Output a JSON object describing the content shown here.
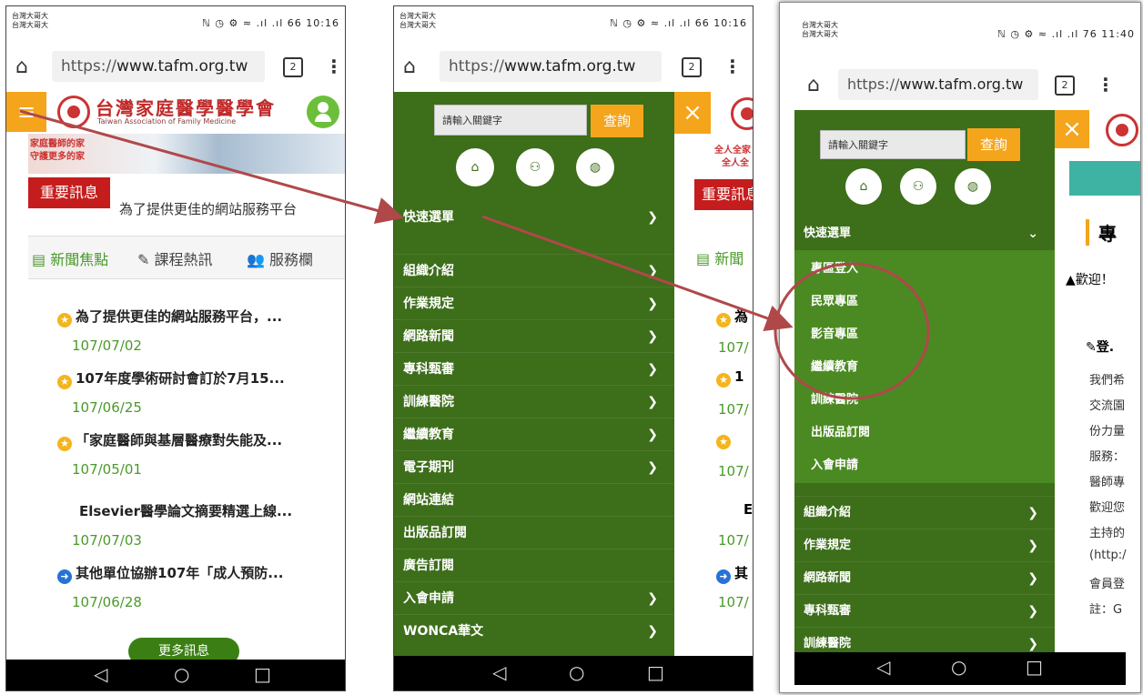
{
  "status": {
    "carrier1": "台灣大哥大\n台灣大哥大",
    "icons1": "ℕ ◷ ⚙ ≈ .ıl .ıl 66 10:16",
    "carrier3": "台灣大哥大\n台灣大哥大",
    "icons3": "ℕ ◷ ⚙ ≈ .ıl .ıl 76 11:40"
  },
  "browser": {
    "url_prefix": "https://",
    "url_host": "www.tafm.org.tw",
    "tab_count": "2"
  },
  "site": {
    "title": "台灣家庭醫學醫學會",
    "subtitle": "Taiwan Association of Family Medicine",
    "banner_lines": [
      "家庭醫師的家",
      "守護更多的家"
    ],
    "banner_peek": [
      "全人全家",
      "全人全"
    ],
    "important": "重要訊息",
    "marquee": "為了提供更佳的網站服務平台",
    "tabs": [
      "新聞焦點",
      "課程熱訊",
      "服務欄"
    ],
    "tab_peek": "新聞",
    "news": [
      {
        "title": "為了提供更佳的網站服務平台，...",
        "date": "107/07/02",
        "icon": "star"
      },
      {
        "title": "107年度學術研討會訂於7月15...",
        "date": "107/06/25",
        "icon": "star"
      },
      {
        "title": "「家庭醫師與基層醫療對失能及...",
        "date": "107/05/01",
        "icon": "star"
      },
      {
        "title": "Elsevier醫學論文摘要精選上線...",
        "date": "107/07/03",
        "icon": "none"
      },
      {
        "title": "其他單位協辦107年「成人預防...",
        "date": "107/06/28",
        "icon": "arrow"
      }
    ],
    "more": "更多訊息"
  },
  "menu": {
    "search_placeholder": "請輸入關鍵字",
    "search_btn": "查詢",
    "quick": "快速選單",
    "items2": [
      "組織介紹",
      "作業規定",
      "網路新聞",
      "專科甄審",
      "訓練醫院",
      "繼續教育",
      "電子期刊",
      "網站連結",
      "出版品訂閱",
      "廣告訂閱",
      "入會申請",
      "WONCA華文"
    ],
    "items2_chevron": [
      true,
      true,
      true,
      true,
      true,
      true,
      true,
      false,
      false,
      false,
      true,
      true
    ],
    "submenu": [
      "專區登入",
      "民眾專區",
      "影音專區",
      "繼續教育",
      "訓練醫院",
      "出版品訂閱",
      "入會申請"
    ],
    "items3": [
      "組織介紹",
      "作業規定",
      "網路新聞",
      "專科甄審",
      "訓練醫院"
    ]
  },
  "peek2": {
    "important": "重要訊息",
    "news_dates": [
      "107/",
      "107/",
      "107/",
      "107/",
      "107/"
    ],
    "news_chars": [
      "為",
      "1",
      "",
      "E",
      "其"
    ]
  },
  "peek3": {
    "heading": "專",
    "welcome": "歡迎！",
    "login": "登.",
    "lines": [
      "我們希",
      "交流園",
      "份力量",
      "服務：",
      "醫師專",
      "歡迎您",
      "主持的",
      "(http:/",
      "會員登",
      "註：G"
    ]
  },
  "colors": {
    "menu_green": "#3d6e1a",
    "submenu_green": "#4b8a22",
    "accent_orange": "#f4a51c",
    "brand_red": "#c02a2a",
    "date_green": "#4a9a2a",
    "annotation": "#b0484a"
  }
}
